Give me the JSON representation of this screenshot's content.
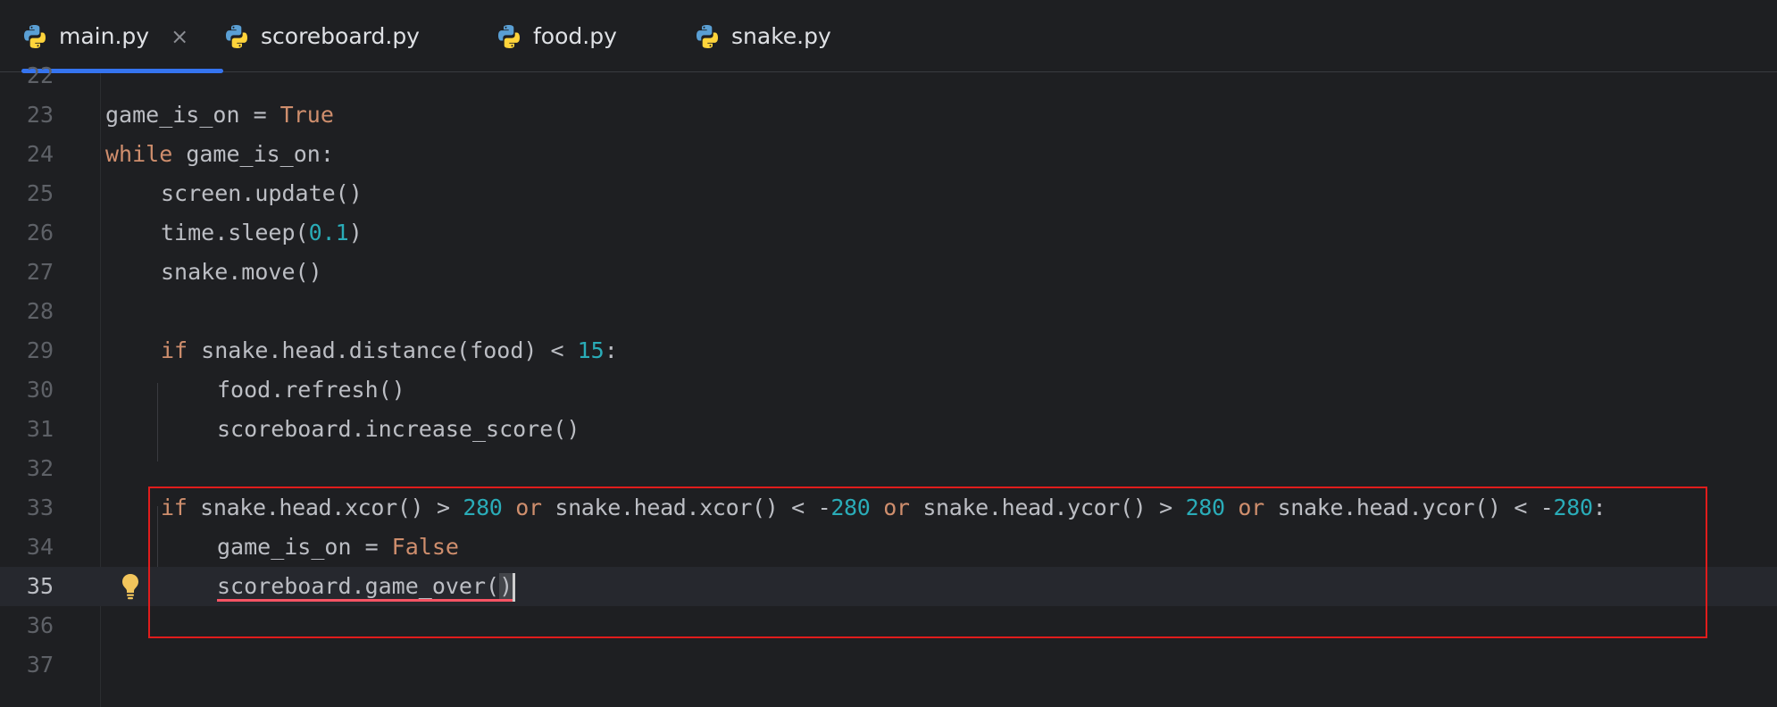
{
  "tabs": [
    {
      "label": "main.py",
      "active": true,
      "close": "×"
    },
    {
      "label": "scoreboard.py",
      "active": false
    },
    {
      "label": "food.py",
      "active": false
    },
    {
      "label": "snake.py",
      "active": false
    }
  ],
  "editor": {
    "current_line": "35",
    "lines": {
      "l22": {
        "num": "22"
      },
      "l23": {
        "num": "23",
        "a": "game_is_on = ",
        "b": "True"
      },
      "l24": {
        "num": "24",
        "a": "while",
        "b": " game_is_on:"
      },
      "l25": {
        "num": "25",
        "a": "screen.update()"
      },
      "l26": {
        "num": "26",
        "a": "time.sleep(",
        "b": "0.1",
        "c": ")"
      },
      "l27": {
        "num": "27",
        "a": "snake.move()"
      },
      "l28": {
        "num": "28"
      },
      "l29": {
        "num": "29",
        "a": "if",
        "b": " snake.head.distance(food) < ",
        "c": "15",
        "d": ":"
      },
      "l30": {
        "num": "30",
        "a": "food.refresh()"
      },
      "l31": {
        "num": "31",
        "a": "scoreboard.increase_score()"
      },
      "l32": {
        "num": "32"
      },
      "l33": {
        "num": "33",
        "t1": "if",
        "t2": " snake.head.xcor() > ",
        "t3": "280",
        "t4": " ",
        "t5": "or",
        "t6": " snake.head.xcor() < -",
        "t7": "280",
        "t8": " ",
        "t9": "or",
        "t10": " snake.head.ycor() > ",
        "t11": "280",
        "t12": " ",
        "t13": "or",
        "t14": " snake.head.ycor() < -",
        "t15": "280",
        "t16": ":"
      },
      "l34": {
        "num": "34",
        "a": "game_is_on = ",
        "b": "False"
      },
      "l35": {
        "num": "35",
        "a": "scoreboard.game_over(",
        "b": ")"
      },
      "l36": {
        "num": "36"
      },
      "l37": {
        "num": "37"
      }
    }
  },
  "colors": {
    "background": "#1e1f22",
    "keyword": "#cf8e6d",
    "number": "#2aacb8",
    "text": "#bcbec4",
    "tab_active_underline": "#3574f0",
    "annotation_box": "#e01c1c",
    "error_squiggle": "#f75464"
  },
  "icons": {
    "tab_icon": "python-icon",
    "gutter_icon": "lightbulb-icon"
  }
}
